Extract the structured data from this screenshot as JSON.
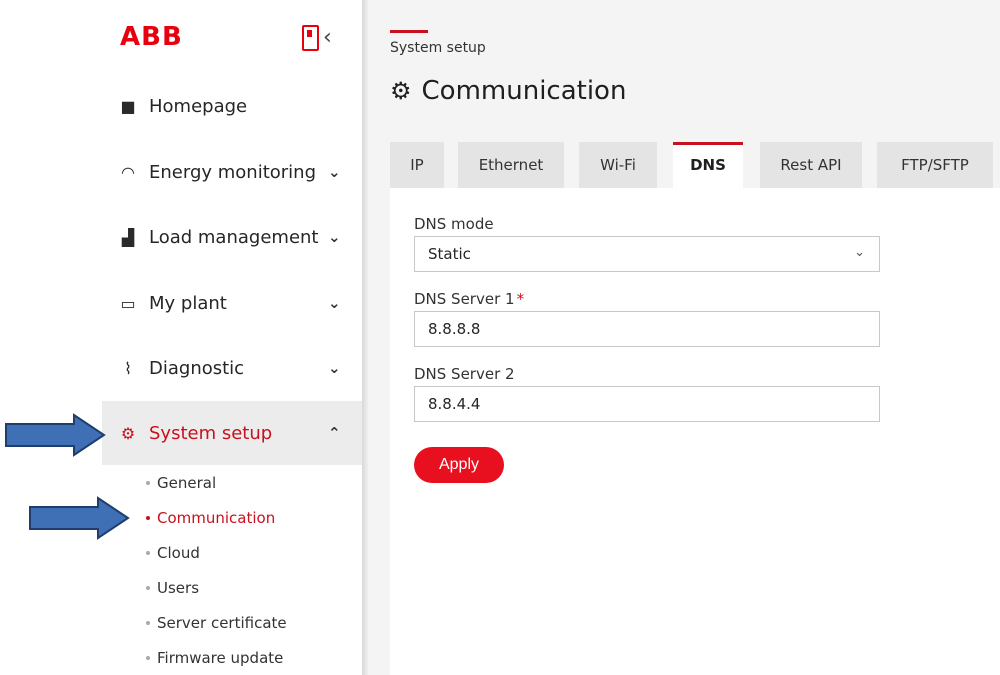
{
  "brand": {
    "logo_text": "ABB",
    "accent_color": "#e8000f"
  },
  "sidebar": {
    "items": [
      {
        "label": "Homepage",
        "icon": "home-icon",
        "expandable": false
      },
      {
        "label": "Energy monitoring",
        "icon": "gauge-icon",
        "expandable": true
      },
      {
        "label": "Load management",
        "icon": "bar-chart-icon",
        "expandable": true
      },
      {
        "label": "My plant",
        "icon": "devices-icon",
        "expandable": true
      },
      {
        "label": "Diagnostic",
        "icon": "pulse-icon",
        "expandable": true
      },
      {
        "label": "System setup",
        "icon": "gear-icon",
        "expandable": true,
        "expanded": true,
        "active": true
      }
    ],
    "sub_items": [
      {
        "label": "General",
        "active": false
      },
      {
        "label": "Communication",
        "active": true
      },
      {
        "label": "Cloud",
        "active": false
      },
      {
        "label": "Users",
        "active": false
      },
      {
        "label": "Server certificate",
        "active": false
      },
      {
        "label": "Firmware update",
        "active": false
      }
    ]
  },
  "main": {
    "breadcrumb": "System setup",
    "title": "Communication",
    "tabs": [
      {
        "label": "IP",
        "active": false
      },
      {
        "label": "Ethernet",
        "active": false
      },
      {
        "label": "Wi-Fi",
        "active": false
      },
      {
        "label": "DNS",
        "active": true
      },
      {
        "label": "Rest API",
        "active": false
      },
      {
        "label": "FTP/SFTP",
        "active": false
      }
    ],
    "form": {
      "dns_mode_label": "DNS mode",
      "dns_mode_value": "Static",
      "dns_server1_label": "DNS Server 1",
      "dns_server1_required": "*",
      "dns_server1_value": "8.8.8.8",
      "dns_server2_label": "DNS Server 2",
      "dns_server2_value": "8.8.4.4",
      "apply_label": "Apply"
    }
  },
  "annotations": {
    "arrow_color": "#3f6fb5"
  }
}
